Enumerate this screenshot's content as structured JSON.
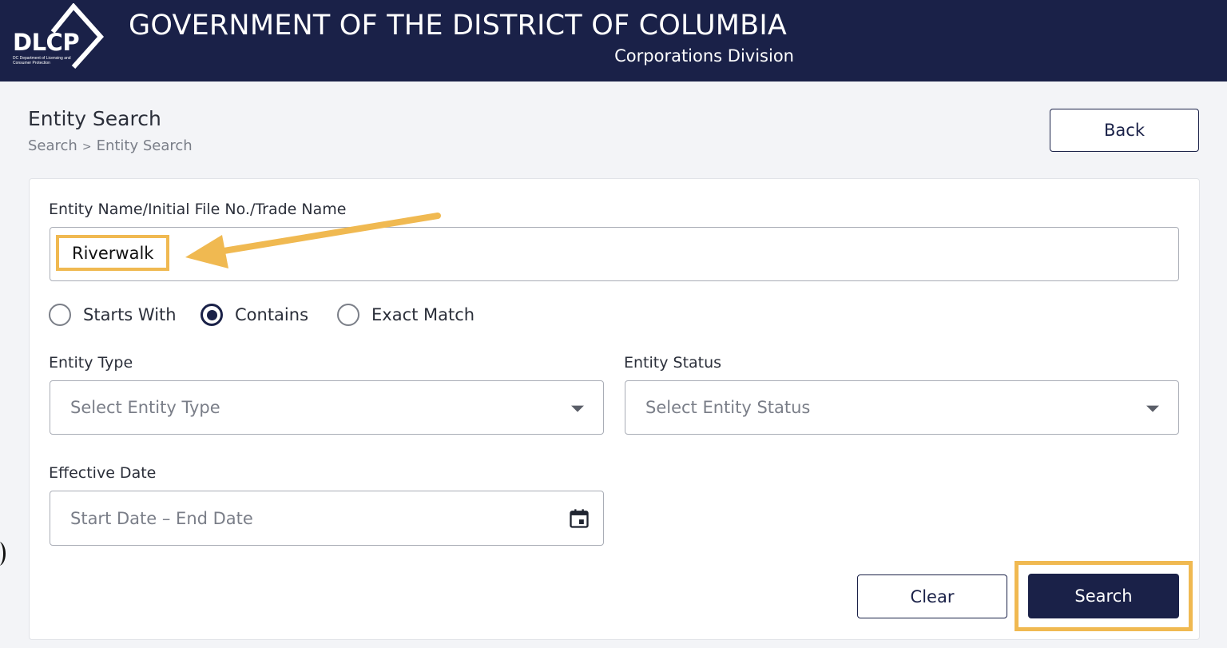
{
  "header": {
    "logo_text": "DLCP",
    "logo_subtext": "DC Department of Licensing and Consumer Protection",
    "title": "GOVERNMENT OF THE DISTRICT OF COLUMBIA",
    "subtitle": "Corporations Division"
  },
  "page": {
    "title": "Entity Search",
    "breadcrumb": [
      "Search",
      "Entity Search"
    ],
    "breadcrumb_separator": ">",
    "back_label": "Back"
  },
  "form": {
    "entity_name_label": "Entity Name/Initial File No./Trade Name",
    "entity_name_value": "Riverwalk",
    "match_options": [
      "Starts With",
      "Contains",
      "Exact Match"
    ],
    "match_selected": "Contains",
    "entity_type_label": "Entity Type",
    "entity_type_placeholder": "Select Entity Type",
    "entity_status_label": "Entity Status",
    "entity_status_placeholder": "Select Entity Status",
    "effective_date_label": "Effective Date",
    "start_date_placeholder": "Start Date",
    "date_separator": "–",
    "end_date_placeholder": "End Date",
    "clear_label": "Clear",
    "search_label": "Search"
  },
  "colors": {
    "header_bg": "#1a2148",
    "accent": "#1a2148",
    "highlight": "#f0b951"
  },
  "icons": {
    "dropdown": "chevron-down-icon",
    "date": "calendar-icon",
    "annotation": "arrow-icon"
  }
}
